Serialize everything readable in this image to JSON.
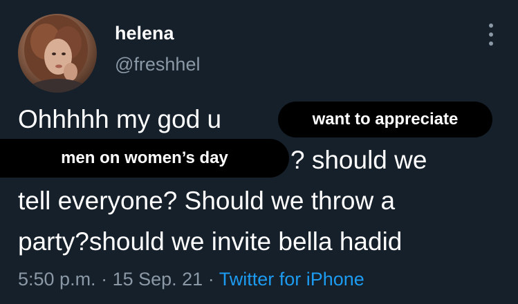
{
  "user": {
    "display_name": "helena",
    "handle": "@freshhel"
  },
  "tweet": {
    "line1": "Ohhhhh my god u",
    "line2": "? should we",
    "line3": "tell everyone? Should we throw a",
    "line4": "party?should we invite bella hadid",
    "redaction_1": "want to appreciate",
    "redaction_2": "men on women’s day"
  },
  "meta": {
    "time": "5:50 p.m.",
    "sep1": " · ",
    "date": "15 Sep. 21",
    "sep2": " · ",
    "source": "Twitter for iPhone"
  },
  "colors": {
    "background": "#15202b",
    "text": "#ffffff",
    "secondary": "#8b98a5",
    "link": "#1d9bf0",
    "redaction": "#000000"
  },
  "icons": {
    "avatar": "profile-photo",
    "more": "more-options-icon"
  }
}
